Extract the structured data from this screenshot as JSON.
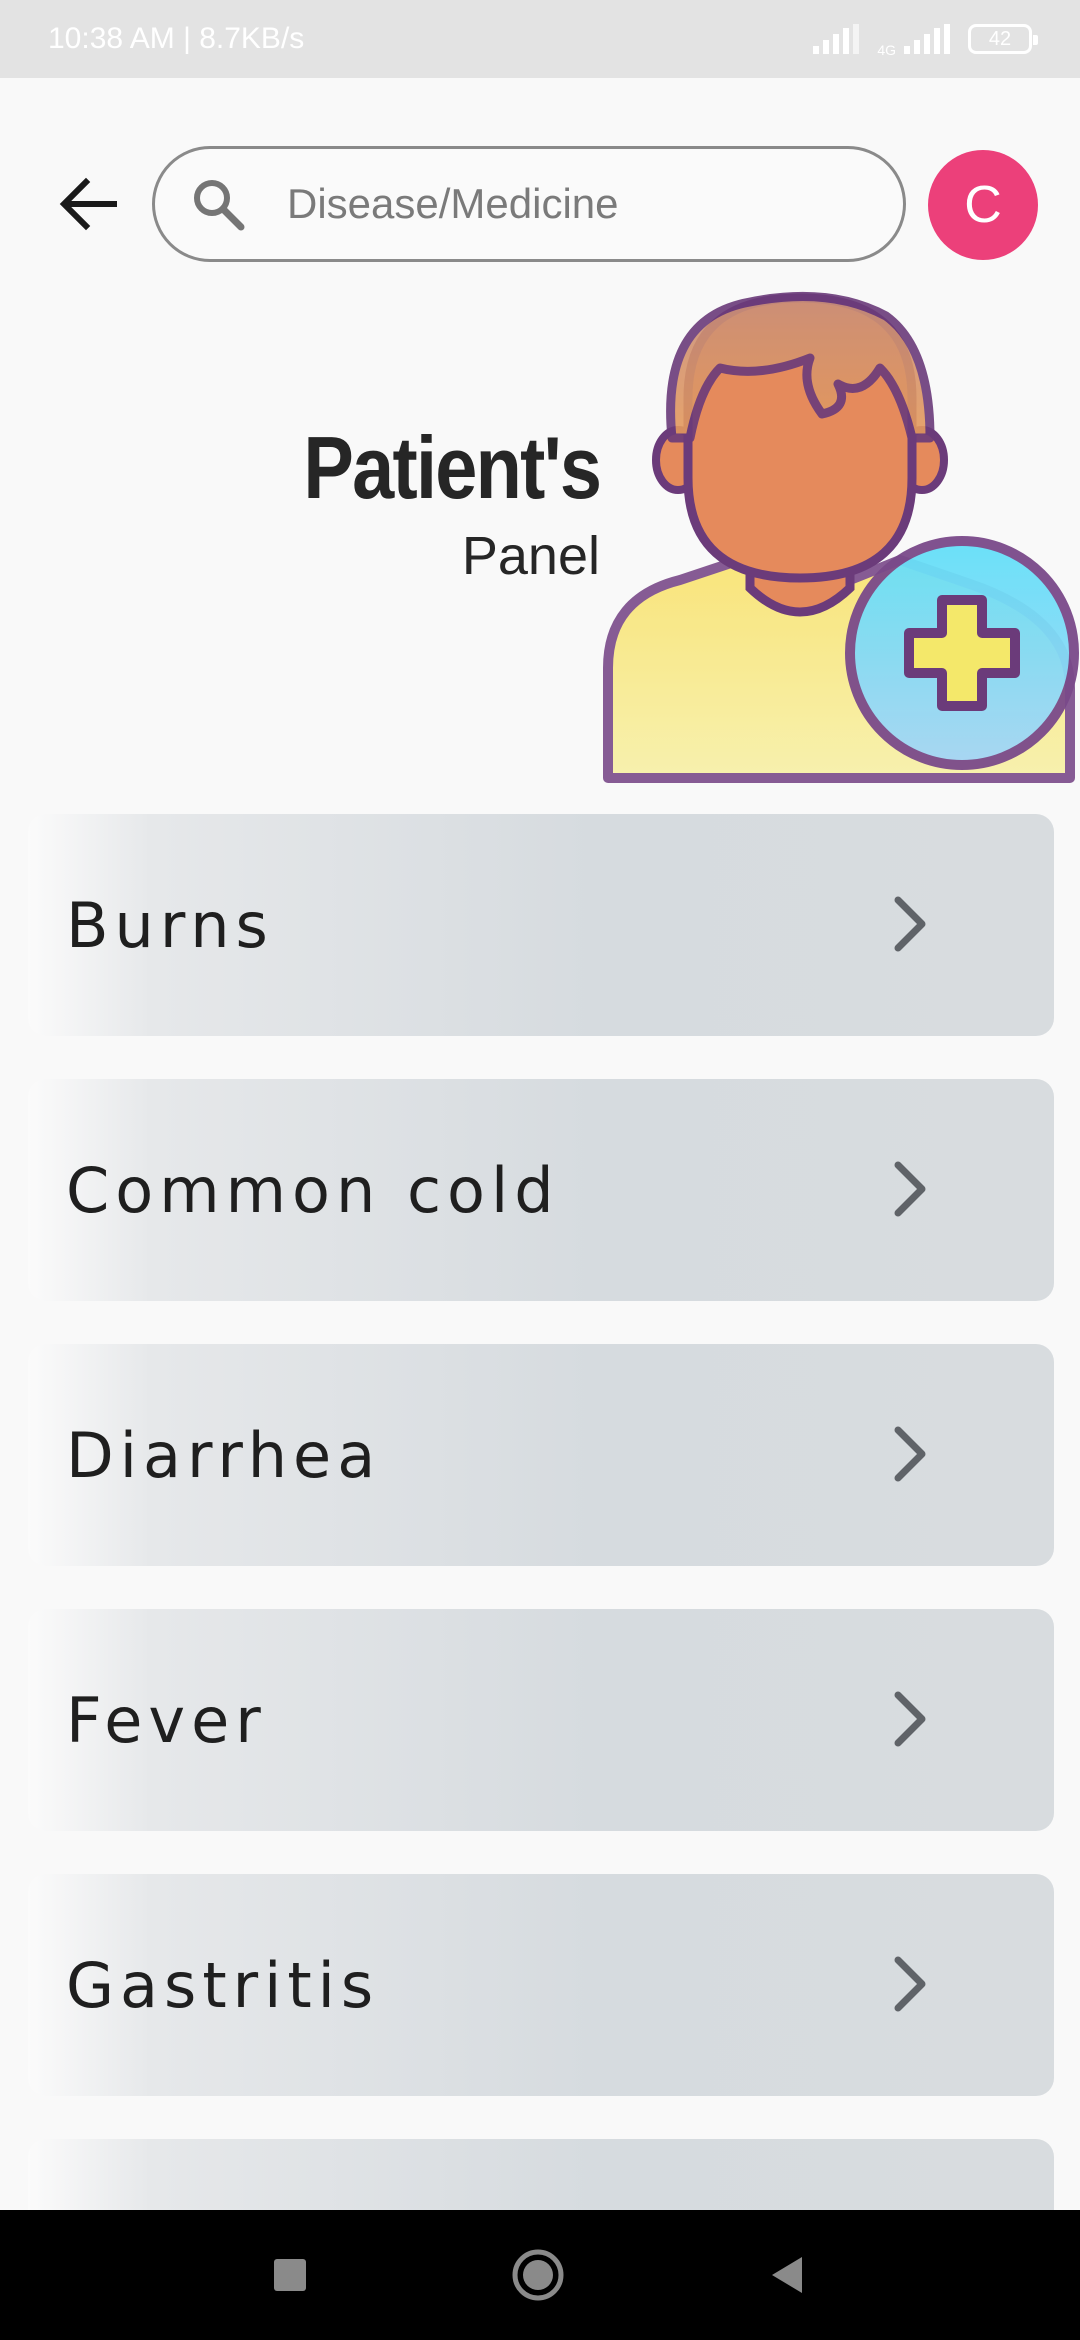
{
  "status_bar": {
    "time_speed": "10:38 AM | 8.7KB/s",
    "network_label": "4G",
    "battery": "42"
  },
  "header": {
    "search_placeholder": "Disease/Medicine",
    "avatar_initial": "C"
  },
  "hero": {
    "title": "Patient's",
    "subtitle": "Panel"
  },
  "diseases": [
    {
      "label": "Burns"
    },
    {
      "label": "Common cold"
    },
    {
      "label": "Diarrhea"
    },
    {
      "label": "Fever"
    },
    {
      "label": "Gastritis"
    },
    {
      "label": ""
    }
  ],
  "colors": {
    "avatar": "#ec407a",
    "list_item": "#d6dbdf",
    "plus_badge": "#6fd6f2",
    "illustration_outline": "#6b3b7a"
  }
}
